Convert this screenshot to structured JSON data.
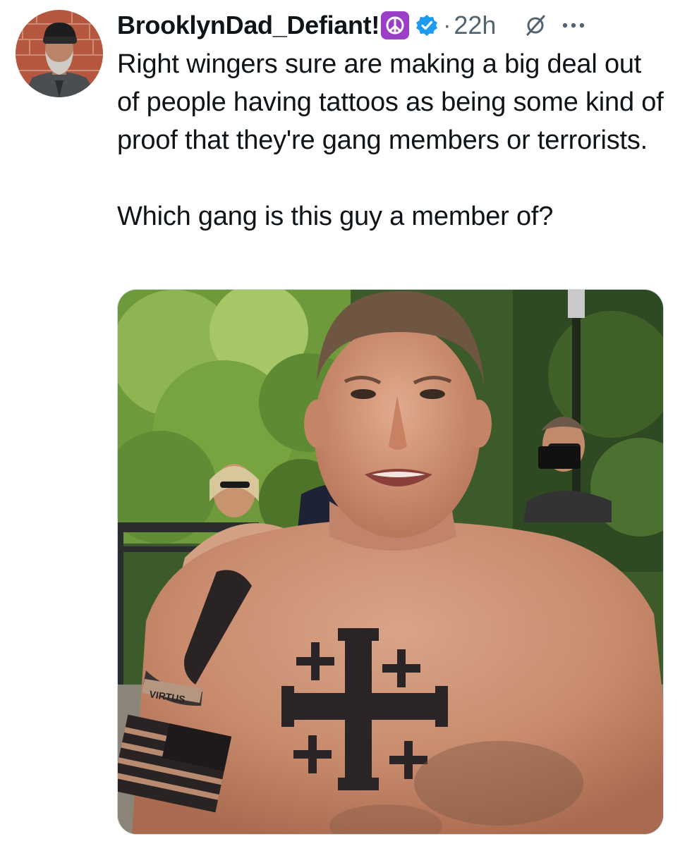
{
  "tweet": {
    "display_name": "BrooklynDad_Defiant!",
    "name_emoji": "☮",
    "separator": "·",
    "timestamp": "22h",
    "text_paragraphs": [
      "Right wingers sure are making a big deal out of people having tattoos as being some kind of proof that they're gang members or terrorists.",
      "Which gang is this guy a member of?"
    ],
    "media_tattoo_text": "VIRTUS"
  },
  "icons": {
    "verified": "verified-badge-icon",
    "grok": "grok-icon",
    "more": "more-options-icon"
  },
  "colors": {
    "text_primary": "#0f1419",
    "text_secondary": "#536471",
    "verified_blue": "#1d9bf0",
    "emoji_purple": "#9b3fc9"
  }
}
